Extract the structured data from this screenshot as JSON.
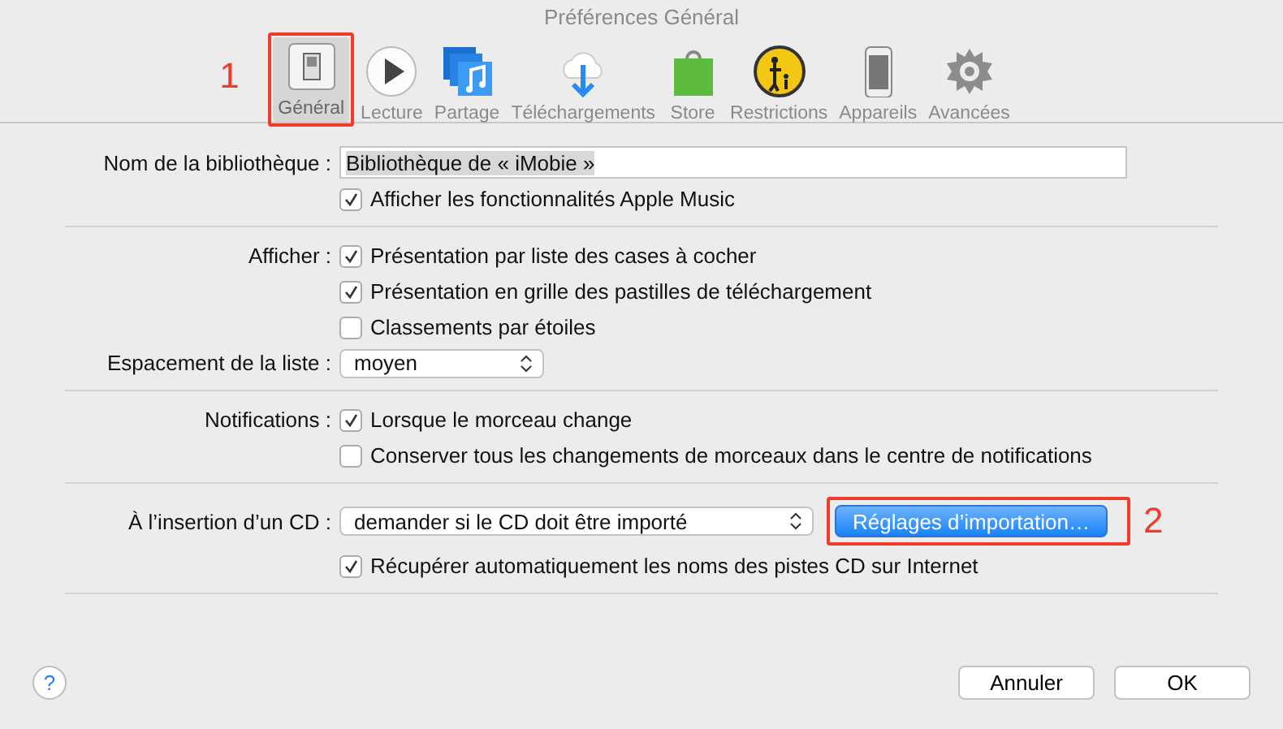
{
  "window": {
    "title": "Préférences Général"
  },
  "tabs": [
    {
      "label": "Général",
      "selected": true,
      "marker": "1"
    },
    {
      "label": "Lecture",
      "selected": false
    },
    {
      "label": "Partage",
      "selected": false
    },
    {
      "label": "Téléchargements",
      "selected": false
    },
    {
      "label": "Store",
      "selected": false
    },
    {
      "label": "Restrictions",
      "selected": false
    },
    {
      "label": "Appareils",
      "selected": false
    },
    {
      "label": "Avancées",
      "selected": false
    }
  ],
  "sections": [
    {
      "rows": [
        {
          "kind": "field",
          "label": "Nom de la bibliothèque :",
          "value": "Bibliothèque de « iMobie »"
        },
        {
          "kind": "checkbox",
          "text": "Afficher les fonctionnalités Apple Music",
          "checked": true
        }
      ]
    },
    {
      "rows": [
        {
          "kind": "checkbox",
          "label": "Afficher :",
          "text": "Présentation par liste des cases à cocher",
          "checked": true
        },
        {
          "kind": "checkbox",
          "text": "Présentation en grille des pastilles de téléchargement",
          "checked": true
        },
        {
          "kind": "checkbox",
          "text": "Classements par étoiles",
          "checked": false
        },
        {
          "kind": "select",
          "label": "Espacement de la liste :",
          "value": "moyen"
        }
      ]
    },
    {
      "rows": [
        {
          "kind": "checkbox",
          "label": "Notifications :",
          "text": "Lorsque le morceau change",
          "checked": true
        },
        {
          "kind": "checkbox",
          "text": "Conserver tous les changements de morceaux dans le centre de notifications",
          "checked": false
        }
      ]
    },
    {
      "rows": [
        {
          "kind": "select",
          "label": "À l’insertion d’un CD :",
          "value": "demander si le CD doit être importé",
          "button": {
            "label": "Réglages d’importation…",
            "marker": "2"
          }
        },
        {
          "kind": "checkbox",
          "text": "Récupérer automatiquement les noms des pistes CD sur Internet",
          "checked": true
        }
      ]
    }
  ],
  "footer": {
    "help": "?",
    "buttons": [
      "Annuler",
      "OK"
    ]
  }
}
